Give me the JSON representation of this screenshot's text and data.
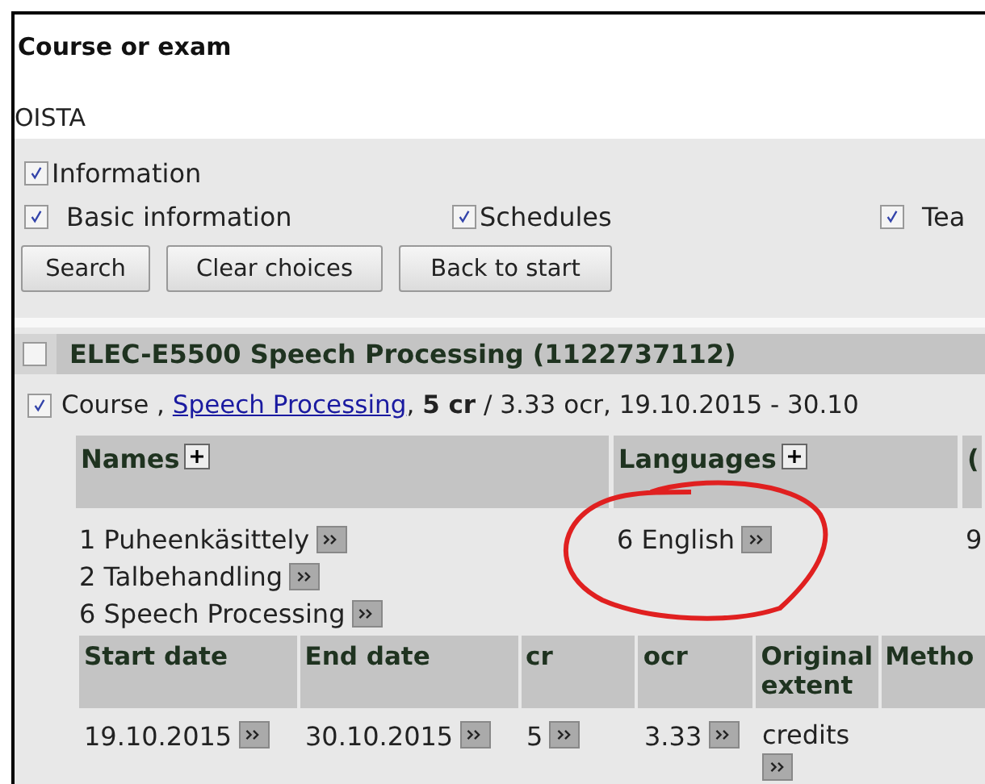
{
  "page_title": "Course or exam",
  "action_link": "OISTA",
  "filters": {
    "group": {
      "label": "Information",
      "checked": true
    },
    "options": [
      {
        "label": "Basic information",
        "checked": true
      },
      {
        "label": "Schedules",
        "checked": true
      },
      {
        "label": "Tea",
        "checked": true
      }
    ]
  },
  "buttons": [
    "Search",
    "Clear choices",
    "Back to start"
  ],
  "course": {
    "title": "ELEC-E5500 Speech Processing (1122737112)",
    "checked": false,
    "realization": {
      "checked": true,
      "type": "Course ,",
      "link": "Speech Processing",
      "after_link": ",",
      "credits": "5 cr",
      "rest": "/ 3.33 ocr, 19.10.2015 - 30.10"
    },
    "info_columns": [
      {
        "label": "Names",
        "expandable": true,
        "values": [
          "1 Puheenkäsittely",
          "2 Talbehandling",
          "6 Speech Processing"
        ]
      },
      {
        "label": "Languages",
        "expandable": true,
        "values": [
          "6 English"
        ]
      },
      {
        "label": "(",
        "expandable": false,
        "values": [
          "9"
        ]
      }
    ],
    "schedule": {
      "columns": [
        "Start date",
        "End date",
        "cr",
        "ocr",
        "Original extent",
        "Metho"
      ],
      "rows": [
        [
          {
            "text": "19.10.2015",
            "details": true
          },
          {
            "text": "30.10.2015",
            "details": true
          },
          {
            "text": "5",
            "details": true
          },
          {
            "text": "3.33",
            "details": true
          },
          {
            "text": "credits",
            "details": true
          }
        ]
      ]
    }
  }
}
